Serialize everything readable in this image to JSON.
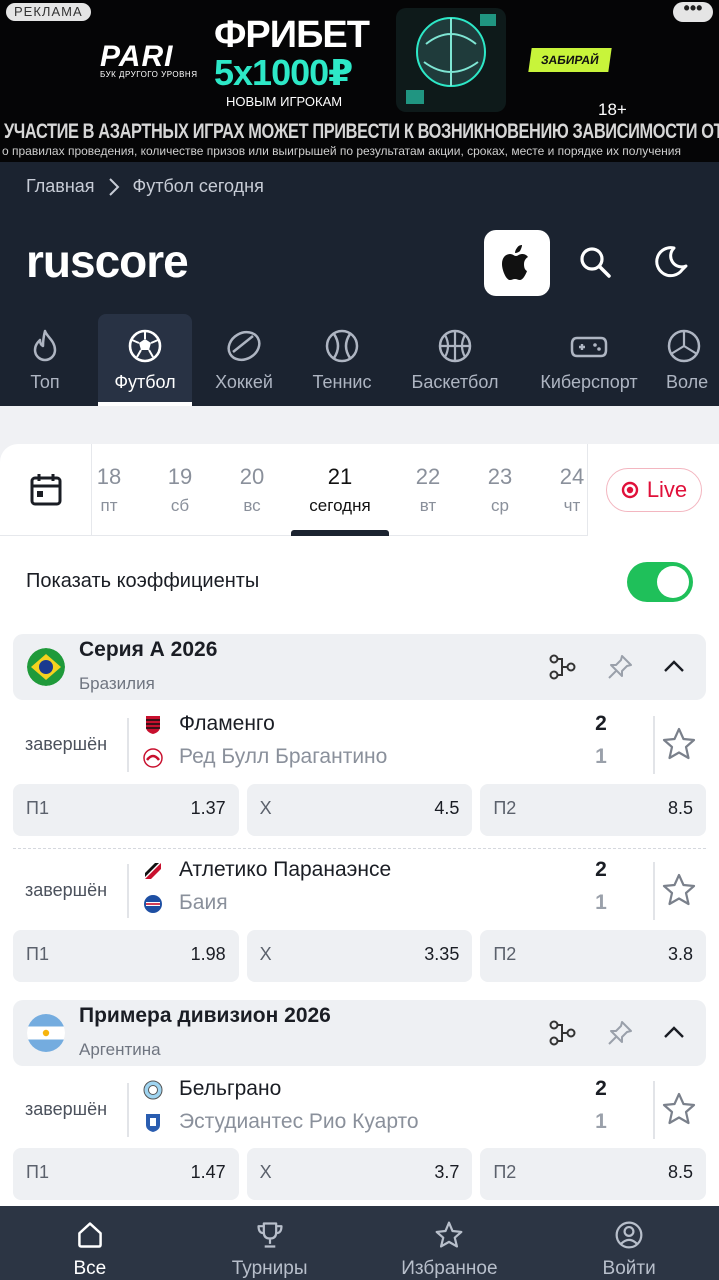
{
  "ad": {
    "tag": "РЕКЛАМА",
    "brand": "PARI",
    "brand_sub": "БУК ДРУГОГО УРОВНЯ",
    "title": "ФРИБЕТ",
    "amount": "5x1000₽",
    "subtitle": "НОВЫМ ИГРОКАМ",
    "cta": "ЗАБИРАЙ",
    "age": "18+",
    "warning": "УЧАСТИЕ В АЗАРТНЫХ ИГРАХ МОЖЕТ ПРИВЕСТИ К ВОЗНИКНОВЕНИЮ ЗАВИСИМОСТИ ОТ АЗАРТНЫХ ИГР",
    "fineprint": "о правилах проведения, количестве призов или выигрышей по результатам акции, сроках, месте и порядке их получения"
  },
  "breadcrumb": {
    "home": "Главная",
    "current": "Футбол сегодня"
  },
  "logo": "ruscore",
  "sports": [
    {
      "label": "Топ",
      "icon": "fire-icon"
    },
    {
      "label": "Футбол",
      "icon": "soccer-ball-icon",
      "active": true
    },
    {
      "label": "Хоккей",
      "icon": "hockey-puck-icon"
    },
    {
      "label": "Теннис",
      "icon": "tennis-ball-icon"
    },
    {
      "label": "Баскетбол",
      "icon": "basketball-icon"
    },
    {
      "label": "Киберспорт",
      "icon": "gamepad-icon"
    },
    {
      "label": "Воле",
      "icon": "volleyball-icon"
    }
  ],
  "dates": [
    {
      "num": "18",
      "dow": "пт"
    },
    {
      "num": "19",
      "dow": "сб"
    },
    {
      "num": "20",
      "dow": "вс"
    },
    {
      "num": "21",
      "dow": "сегодня",
      "active": true
    },
    {
      "num": "22",
      "dow": "вт"
    },
    {
      "num": "23",
      "dow": "ср"
    },
    {
      "num": "24",
      "dow": "чт"
    }
  ],
  "live_label": "Live",
  "show_odds_label": "Показать коэффициенты",
  "show_odds_enabled": true,
  "colors": {
    "accent_green": "#1fc05a",
    "live_red": "#e0103a",
    "header_bg": "#1b2330"
  },
  "leagues": [
    {
      "name": "Серия А 2026",
      "country": "Бразилия",
      "matches": [
        {
          "status": "завершён",
          "home": "Фламенго",
          "away": "Ред Булл Брагантино",
          "home_score": "2",
          "away_score": "1",
          "odds": [
            {
              "label": "П1",
              "value": "1.37"
            },
            {
              "label": "Х",
              "value": "4.5"
            },
            {
              "label": "П2",
              "value": "8.5"
            }
          ]
        },
        {
          "status": "завершён",
          "home": "Атлетико Паранаэнсе",
          "away": "Баия",
          "home_score": "2",
          "away_score": "1",
          "odds": [
            {
              "label": "П1",
              "value": "1.98"
            },
            {
              "label": "Х",
              "value": "3.35"
            },
            {
              "label": "П2",
              "value": "3.8"
            }
          ]
        }
      ]
    },
    {
      "name": "Примера дивизион 2026",
      "country": "Аргентина",
      "matches": [
        {
          "status": "завершён",
          "home": "Бельграно",
          "away": "Эстудиантес Рио Куарто",
          "home_score": "2",
          "away_score": "1",
          "odds": [
            {
              "label": "П1",
              "value": "1.47"
            },
            {
              "label": "Х",
              "value": "3.7"
            },
            {
              "label": "П2",
              "value": "8.5"
            }
          ]
        }
      ]
    }
  ],
  "bottom_nav": [
    {
      "label": "Все",
      "icon": "home-icon",
      "active": true
    },
    {
      "label": "Турниры",
      "icon": "trophy-icon"
    },
    {
      "label": "Избранное",
      "icon": "star-icon"
    },
    {
      "label": "Войти",
      "icon": "user-icon"
    }
  ]
}
